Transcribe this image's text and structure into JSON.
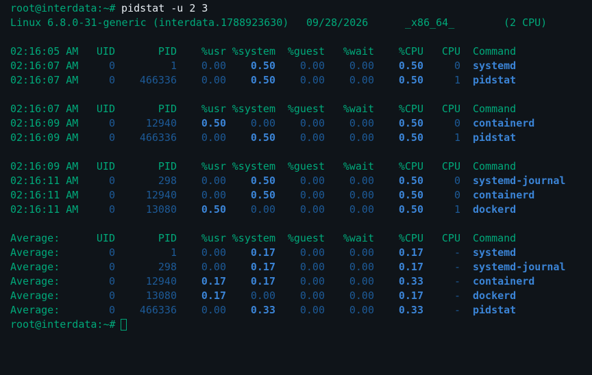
{
  "terminal": {
    "prompt": "root@interdata:~#",
    "command": " pidstat -u 2 3",
    "sysinfo": {
      "kernel": "Linux 6.8.0-31-generic (interdata.1788923630)",
      "date": "09/28/2026",
      "arch": "_x86_64_",
      "cpus": "(2 CPU)"
    },
    "blocks": [
      {
        "header": {
          "time": "02:16:05 AM",
          "uid": "UID",
          "pid": "PID",
          "usr": "%usr",
          "system": "%system",
          "guest": "%guest",
          "wait": "%wait",
          "cpu_pct": "%CPU",
          "cpu": "CPU",
          "command": "Command"
        },
        "rows": [
          {
            "time": "02:16:07 AM",
            "uid": "0",
            "pid": "1",
            "usr": "0.00",
            "system": "0.50",
            "guest": "0.00",
            "wait": "0.00",
            "cpu_pct": "0.50",
            "cpu": "0",
            "command": "systemd"
          },
          {
            "time": "02:16:07 AM",
            "uid": "0",
            "pid": "466336",
            "usr": "0.00",
            "system": "0.50",
            "guest": "0.00",
            "wait": "0.00",
            "cpu_pct": "0.50",
            "cpu": "1",
            "command": "pidstat"
          }
        ]
      },
      {
        "header": {
          "time": "02:16:07 AM",
          "uid": "UID",
          "pid": "PID",
          "usr": "%usr",
          "system": "%system",
          "guest": "%guest",
          "wait": "%wait",
          "cpu_pct": "%CPU",
          "cpu": "CPU",
          "command": "Command"
        },
        "rows": [
          {
            "time": "02:16:09 AM",
            "uid": "0",
            "pid": "12940",
            "usr": "0.50",
            "system": "0.00",
            "guest": "0.00",
            "wait": "0.00",
            "cpu_pct": "0.50",
            "cpu": "0",
            "command": "containerd"
          },
          {
            "time": "02:16:09 AM",
            "uid": "0",
            "pid": "466336",
            "usr": "0.00",
            "system": "0.50",
            "guest": "0.00",
            "wait": "0.00",
            "cpu_pct": "0.50",
            "cpu": "1",
            "command": "pidstat"
          }
        ]
      },
      {
        "header": {
          "time": "02:16:09 AM",
          "uid": "UID",
          "pid": "PID",
          "usr": "%usr",
          "system": "%system",
          "guest": "%guest",
          "wait": "%wait",
          "cpu_pct": "%CPU",
          "cpu": "CPU",
          "command": "Command"
        },
        "rows": [
          {
            "time": "02:16:11 AM",
            "uid": "0",
            "pid": "298",
            "usr": "0.00",
            "system": "0.50",
            "guest": "0.00",
            "wait": "0.00",
            "cpu_pct": "0.50",
            "cpu": "0",
            "command": "systemd-journal"
          },
          {
            "time": "02:16:11 AM",
            "uid": "0",
            "pid": "12940",
            "usr": "0.00",
            "system": "0.50",
            "guest": "0.00",
            "wait": "0.00",
            "cpu_pct": "0.50",
            "cpu": "0",
            "command": "containerd"
          },
          {
            "time": "02:16:11 AM",
            "uid": "0",
            "pid": "13080",
            "usr": "0.50",
            "system": "0.00",
            "guest": "0.00",
            "wait": "0.00",
            "cpu_pct": "0.50",
            "cpu": "1",
            "command": "dockerd"
          }
        ]
      },
      {
        "header": {
          "time": "Average:",
          "uid": "UID",
          "pid": "PID",
          "usr": "%usr",
          "system": "%system",
          "guest": "%guest",
          "wait": "%wait",
          "cpu_pct": "%CPU",
          "cpu": "CPU",
          "command": "Command"
        },
        "rows": [
          {
            "time": "Average:",
            "uid": "0",
            "pid": "1",
            "usr": "0.00",
            "system": "0.17",
            "guest": "0.00",
            "wait": "0.00",
            "cpu_pct": "0.17",
            "cpu": "-",
            "command": "systemd"
          },
          {
            "time": "Average:",
            "uid": "0",
            "pid": "298",
            "usr": "0.00",
            "system": "0.17",
            "guest": "0.00",
            "wait": "0.00",
            "cpu_pct": "0.17",
            "cpu": "-",
            "command": "systemd-journal"
          },
          {
            "time": "Average:",
            "uid": "0",
            "pid": "12940",
            "usr": "0.17",
            "system": "0.17",
            "guest": "0.00",
            "wait": "0.00",
            "cpu_pct": "0.33",
            "cpu": "-",
            "command": "containerd"
          },
          {
            "time": "Average:",
            "uid": "0",
            "pid": "13080",
            "usr": "0.17",
            "system": "0.00",
            "guest": "0.00",
            "wait": "0.00",
            "cpu_pct": "0.17",
            "cpu": "-",
            "command": "dockerd"
          },
          {
            "time": "Average:",
            "uid": "0",
            "pid": "466336",
            "usr": "0.00",
            "system": "0.33",
            "guest": "0.00",
            "wait": "0.00",
            "cpu_pct": "0.33",
            "cpu": "-",
            "command": "pidstat"
          }
        ]
      }
    ],
    "final_prompt": "root@interdata:~#"
  },
  "colors": {
    "background": "#0f1419",
    "prompt_green": "#00a97a",
    "value_dim": "#1d5a97",
    "value_bright": "#3b84d6",
    "text_white": "#e7edf2"
  }
}
